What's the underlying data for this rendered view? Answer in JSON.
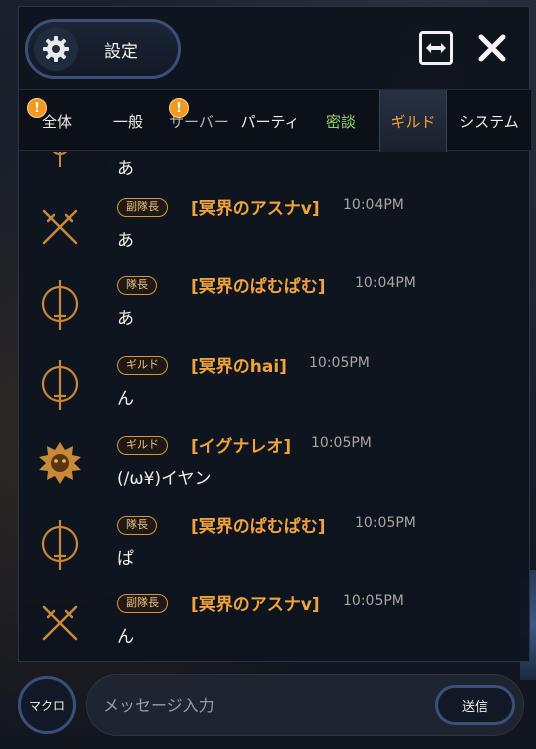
{
  "header": {
    "settings_label": "設定"
  },
  "tabs": [
    {
      "label": "全体",
      "badge": "!"
    },
    {
      "label": "一般"
    },
    {
      "label": "サーバー",
      "badge": "!"
    },
    {
      "label": "パーティ"
    },
    {
      "label": "密談"
    },
    {
      "label": "ギルド"
    },
    {
      "label": "システム"
    }
  ],
  "messages": {
    "partial": {
      "text": "あ"
    },
    "items": [
      {
        "rank": "副隊長",
        "name": "[冥界のアスナv]",
        "time": "10:04PM",
        "text": "あ",
        "avatar": "crossed-swords-icon"
      },
      {
        "rank": "隊長",
        "name": "[冥界のぱむぱむ]",
        "time": "10:04PM",
        "text": "あ",
        "avatar": "sword-emblem-icon"
      },
      {
        "rank": "ギルド",
        "name": "[冥界のhai]",
        "time": "10:05PM",
        "text": "ん",
        "avatar": "sword-emblem-icon"
      },
      {
        "rank": "ギルド",
        "name": "[イグナレオ]",
        "time": "10:05PM",
        "text": "(/ω¥)イヤン",
        "avatar": "lion-emblem-icon"
      },
      {
        "rank": "隊長",
        "name": "[冥界のぱむぱむ]",
        "time": "10:05PM",
        "text": "ぱ",
        "avatar": "sword-emblem-icon"
      },
      {
        "rank": "副隊長",
        "name": "[冥界のアスナv]",
        "time": "10:05PM",
        "text": "ん",
        "avatar": "crossed-swords-icon"
      }
    ]
  },
  "footer": {
    "macro_label": "マクロ",
    "input_placeholder": "メッセージ入力",
    "send_label": "送信"
  },
  "colors": {
    "accent": "#f0a23c",
    "tab_green": "#8fd66f",
    "badge": "#f29a1f"
  }
}
